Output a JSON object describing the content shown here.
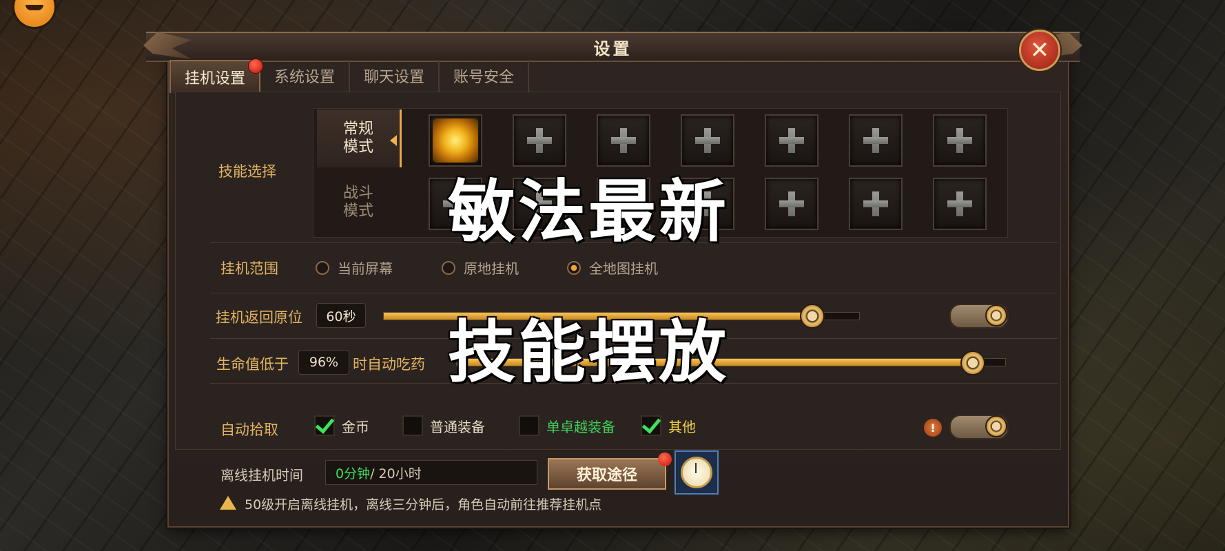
{
  "title": "设置",
  "close_icon": "close-x-icon",
  "tabs": [
    {
      "label": "挂机设置",
      "active": true,
      "badge": true
    },
    {
      "label": "系统设置",
      "active": false
    },
    {
      "label": "聊天设置",
      "active": false
    },
    {
      "label": "账号安全",
      "active": false
    }
  ],
  "skills": {
    "label": "技能选择",
    "modes": [
      "常规\n模式",
      "战斗\n模式"
    ],
    "mode_regular_1": "常规",
    "mode_regular_2": "模式",
    "mode_battle_1": "战斗",
    "mode_battle_2": "模式"
  },
  "range": {
    "label": "挂机范围",
    "options": [
      "当前屏幕",
      "原地挂机",
      "全地图挂机"
    ],
    "selected": "全地图挂机"
  },
  "return_origin": {
    "label": "挂机返回原位",
    "value": "60秒",
    "slider_fraction": 0.9,
    "toggle_on": true
  },
  "auto_potion": {
    "label": "生命值低于",
    "value": "96%",
    "suffix": "时自动吃药",
    "slider_fraction": 0.94
  },
  "auto_pickup": {
    "label": "自动拾取",
    "options": [
      {
        "label": "金币",
        "checked": true,
        "color": "#e9dcc6"
      },
      {
        "label": "普通装备",
        "checked": false,
        "color": "#e9dcc6"
      },
      {
        "label": "单卓越装备",
        "checked": false,
        "color": "#3fd35a"
      },
      {
        "label": "其他",
        "checked": true,
        "color": "#f1d24a"
      }
    ],
    "toggle_on": true,
    "info_icon": "!"
  },
  "offline": {
    "label": "离线挂机时间",
    "used": "0分钟",
    "total": " / 20小时",
    "get_button": "获取途径",
    "clock_icon": "pocket-watch-icon",
    "notice": "50级开启离线挂机，离线三分钟后，角色自动前往推荐挂机点"
  },
  "overlay": {
    "line1": "敏法最新",
    "line2": "技能摆放"
  },
  "colors": {
    "accent_gold": "#e2b461",
    "highlight_green": "#3fe05a",
    "badge_red": "#c4120a"
  }
}
